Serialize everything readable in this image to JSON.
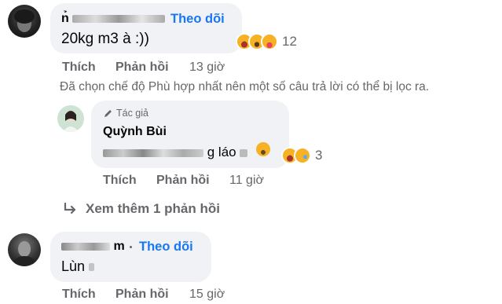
{
  "comment1": {
    "name_visible": "n̉",
    "follow": "Theo dõi",
    "text": "20kg m3 à :))",
    "reaction_icons": [
      "haha-icon",
      "wow-icon",
      "care-icon"
    ],
    "reaction_count": "12",
    "actions": {
      "like": "Thích",
      "reply": "Phản hồi",
      "time": "13 giờ"
    }
  },
  "filter_notice": "Đã chọn chế độ Phù hợp nhất nên một số câu trả lời có thể bị lọc ra.",
  "reply1": {
    "badge": "Tác giả",
    "name": "Quỳnh Bùi",
    "text_visible": "g láo",
    "reaction_icons": [
      "haha-icon",
      "sad-icon"
    ],
    "reaction_count": "3",
    "actions": {
      "like": "Thích",
      "reply": "Phản hồi",
      "time": "11 giờ"
    }
  },
  "more_replies": "Xem thêm 1 phản hồi",
  "comment2": {
    "name_visible": "m",
    "follow": "Theo dõi",
    "text_visible": "Lùn",
    "actions": {
      "like": "Thích",
      "reply": "Phản hồi",
      "time": "15 giờ"
    }
  },
  "colors": {
    "link": "#1877f2",
    "secondary": "#65676b",
    "bubble": "#f0f2f5"
  }
}
